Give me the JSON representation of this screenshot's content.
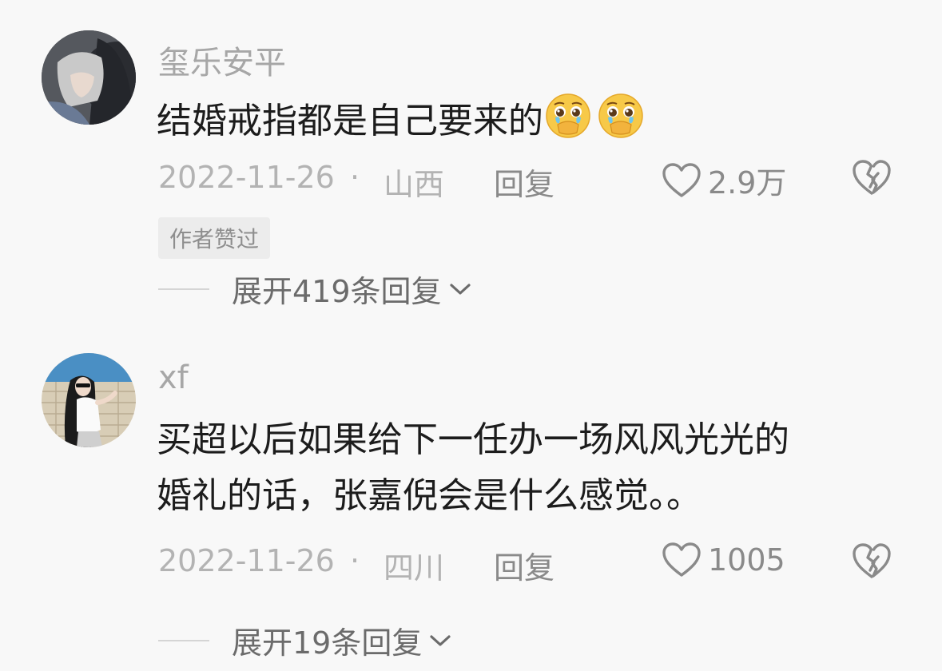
{
  "comments": [
    {
      "username": "玺乐安平",
      "text": "结婚戒指都是自己要来的",
      "emojis": [
        "pleading-crying-face-icon",
        "pleading-crying-face-icon"
      ],
      "date": "2022-11-26",
      "separator": "·",
      "location": "山西",
      "reply_label": "回复",
      "likes": "2.9万",
      "badge": "作者赞过",
      "expand_label": "展开419条回复"
    },
    {
      "username": "xf",
      "text_line1": "买超以后如果给下一任办一场风风光光的",
      "text_line2": "婚礼的话，张嘉倪会是什么感觉。。",
      "date": "2022-11-26",
      "separator": "·",
      "location": "四川",
      "reply_label": "回复",
      "likes": "1005",
      "expand_label": "展开19条回复"
    }
  ],
  "colors": {
    "background": "#f8f8f8",
    "username": "#a7a7a7",
    "body_text": "#1c1c1c",
    "meta": "#b3b3b3",
    "action": "#8a8a8a"
  }
}
